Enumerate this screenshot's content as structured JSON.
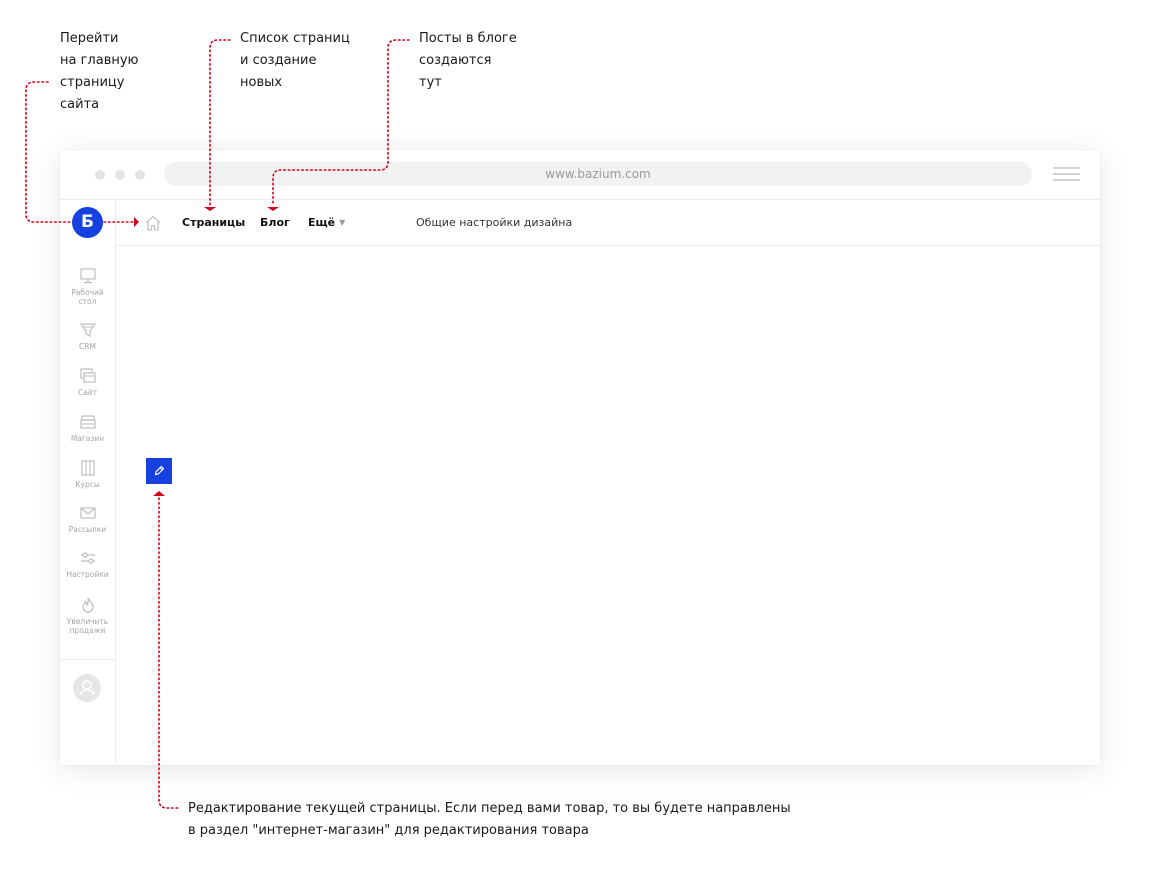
{
  "annotations": {
    "home": "Перейти\nна главную\nстраницу\nсайта",
    "pages": "Список страниц\nи создание\nновых",
    "blog": "Посты в блоге\nсоздаются\nтут",
    "edit": "Редактирование текущей страницы. Если перед вами товар, то вы будете направлены\nв раздел \"интернет-магазин\" для редактирования товара"
  },
  "browser": {
    "url": "www.bazium.com"
  },
  "logo": {
    "letter": "Б"
  },
  "nav": {
    "pages": "Страницы",
    "blog": "Блог",
    "more": "Ещё",
    "design_settings": "Общие настройки дизайна"
  },
  "sidebar": {
    "items": [
      {
        "label": "Рабочий\nстол",
        "icon": "monitor-icon"
      },
      {
        "label": "CRM",
        "icon": "funnel-icon"
      },
      {
        "label": "Сайт",
        "icon": "windows-icon"
      },
      {
        "label": "Магазин",
        "icon": "store-icon"
      },
      {
        "label": "Курсы",
        "icon": "courses-icon"
      },
      {
        "label": "Рассылки",
        "icon": "mail-icon"
      },
      {
        "label": "Настройки",
        "icon": "sliders-icon"
      },
      {
        "label": "Увеличить\nпродажи",
        "icon": "flame-icon"
      }
    ]
  },
  "colors": {
    "accent": "#1740e0",
    "annotation_line": "#d0021b"
  }
}
